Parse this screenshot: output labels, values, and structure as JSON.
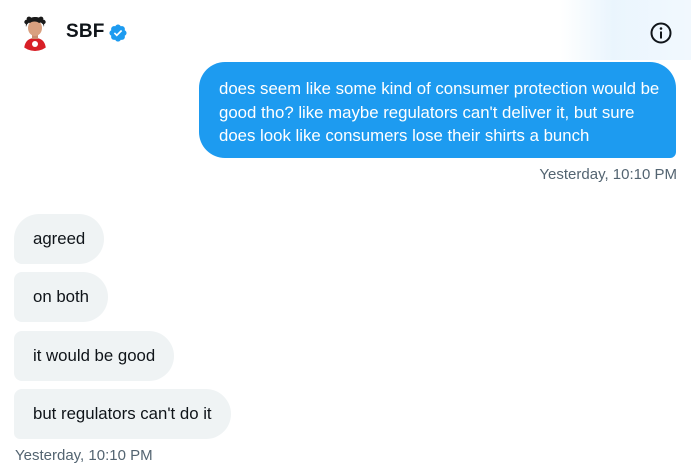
{
  "header": {
    "contact_name": "SBF",
    "verified_icon": "verified-badge-icon",
    "info_icon": "info-icon",
    "avatar_icon": "avatar"
  },
  "messages": {
    "sent": [
      {
        "text": "does seem like some kind of consumer protection would be good tho? like maybe regulators can't deliver it, but sure does look like consumers lose their shirts a bunch",
        "timestamp": "Yesterday, 10:10 PM"
      }
    ],
    "received": [
      {
        "text": "agreed"
      },
      {
        "text": "on both"
      },
      {
        "text": "it would be good"
      },
      {
        "text": "but regulators can't do it"
      }
    ],
    "received_timestamp": "Yesterday, 10:10 PM"
  },
  "colors": {
    "accent": "#1d9bf0",
    "received_bubble": "#eff3f4",
    "timestamp": "#536471",
    "text": "#0f1419"
  }
}
